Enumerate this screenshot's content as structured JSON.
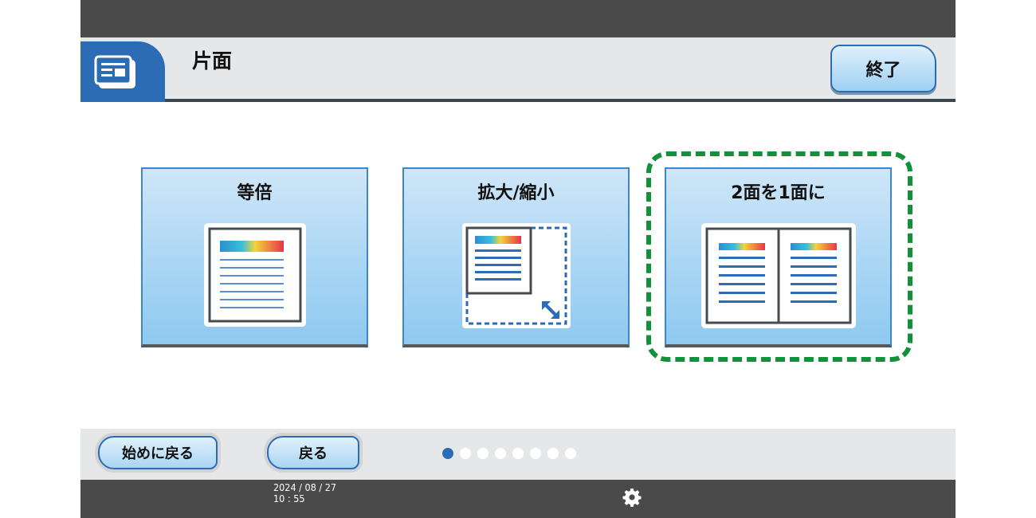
{
  "header": {
    "title": "片面",
    "end_button": "終了",
    "app_icon": "document-icon"
  },
  "options": [
    {
      "label": "等倍",
      "icon": "same-size-page-icon"
    },
    {
      "label": "拡大/縮小",
      "icon": "enlarge-reduce-icon"
    },
    {
      "label": "2面を1面に",
      "icon": "two-pages-to-one-icon",
      "highlighted": true
    }
  ],
  "footer": {
    "home_button": "始めに戻る",
    "back_button": "戻る",
    "pagination": {
      "current": 1,
      "total": 8
    }
  },
  "status": {
    "date": "2024 / 08 / 27",
    "time": "10 : 55",
    "settings_icon": "gear-icon"
  },
  "colors": {
    "accent": "#2b6cb5",
    "highlight": "#12913a",
    "panel": "#a9d6f4",
    "bar": "#4a4a4a"
  }
}
